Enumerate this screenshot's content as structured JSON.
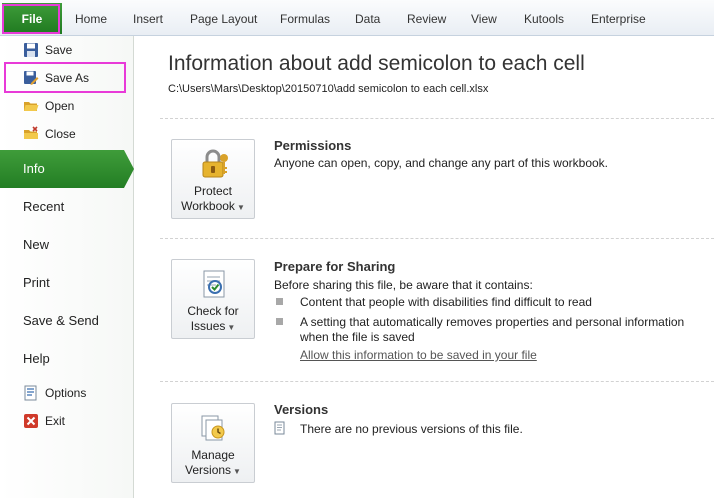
{
  "ribbon": {
    "file_tab": "File",
    "tabs": [
      "Home",
      "Insert",
      "Page Layout",
      "Formulas",
      "Data",
      "Review",
      "View",
      "Kutools",
      "Enterprise"
    ]
  },
  "nav": {
    "save": "Save",
    "save_as": "Save As",
    "open": "Open",
    "close": "Close",
    "info": "Info",
    "recent": "Recent",
    "new": "New",
    "print": "Print",
    "save_send": "Save & Send",
    "help": "Help",
    "options": "Options",
    "exit": "Exit"
  },
  "info": {
    "title": "Information about add semicolon to each cell",
    "path": "C:\\Users\\Mars\\Desktop\\20150710\\add semicolon to each cell.xlsx"
  },
  "permissions": {
    "button_line1": "Protect",
    "button_line2": "Workbook",
    "title": "Permissions",
    "text": "Anyone can open, copy, and change any part of this workbook."
  },
  "sharing": {
    "button_line1": "Check for",
    "button_line2": "Issues",
    "title": "Prepare for Sharing",
    "intro": "Before sharing this file, be aware that it contains:",
    "bullet1": "Content that people with disabilities find difficult to read",
    "bullet2_line1": "A setting that automatically removes properties and personal information",
    "bullet2_line2": "when the file is saved",
    "link": "Allow this information to be saved in your file"
  },
  "versions": {
    "button_line1": "Manage",
    "button_line2": "Versions",
    "title": "Versions",
    "text": "There are no previous versions of this file."
  },
  "colors": {
    "accent_green": "#2b8a2b",
    "highlight_magenta": "#e83ad8"
  }
}
